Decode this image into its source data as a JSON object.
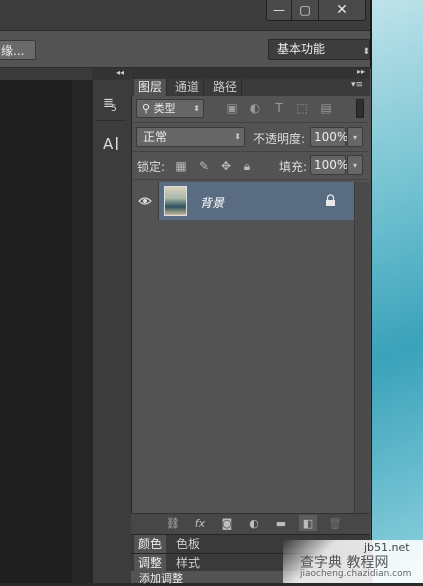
{
  "window": {
    "min_glyph": "—",
    "max_glyph": "▢",
    "close_glyph": "✕"
  },
  "options_bar": {
    "edge_button_label": "缘...",
    "workspace_label": "基本功能"
  },
  "dock": {
    "collapse_glyph": "◂◂",
    "icons": [
      "paragraph-icon",
      "character-icon"
    ]
  },
  "layers_panel": {
    "expand_glyph": "▸▸",
    "tabs": [
      "图层",
      "通道",
      "路径"
    ],
    "filter_kind": "类型",
    "blend_mode": "正常",
    "opacity_label": "不透明度:",
    "opacity_value": "100%",
    "lock_label": "锁定:",
    "fill_label": "填充:",
    "fill_value": "100%",
    "layers": [
      {
        "name": "背景",
        "visible": true,
        "locked": true
      }
    ]
  },
  "bottom_panels": {
    "group1_tabs": [
      "颜色",
      "色板"
    ],
    "group2_tabs": [
      "调整",
      "样式"
    ],
    "group3_label": "添加调整"
  },
  "watermark": {
    "title": "查字典 教程网",
    "site": "jb51.net",
    "url": "jiaocheng.chazidian.com"
  },
  "colors": {
    "panel_bg": "#535353",
    "selected_layer": "#5a6c82",
    "title_bar": "#3c3c3c"
  }
}
